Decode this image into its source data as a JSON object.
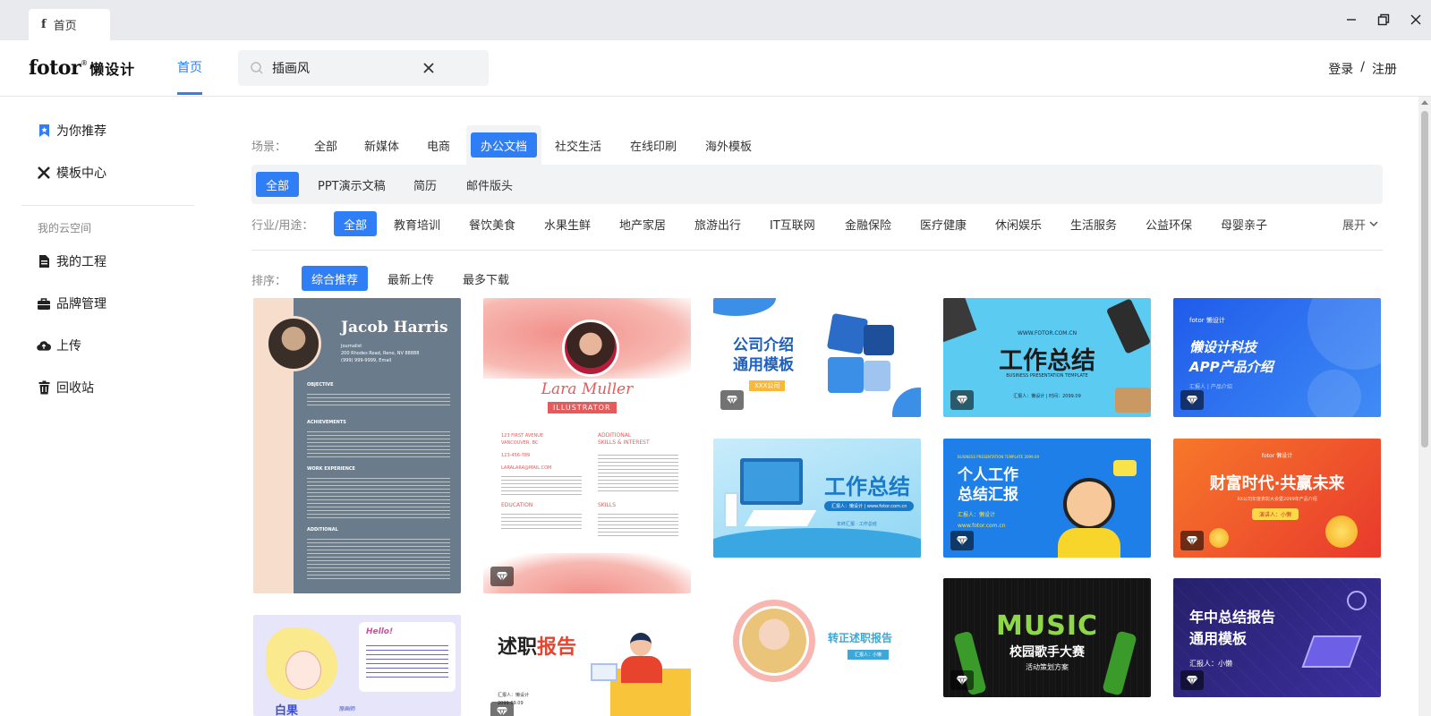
{
  "window": {
    "tab_label": "首页",
    "tab_icon": "f"
  },
  "header": {
    "logo_text": "fotor",
    "logo_reg": "®",
    "logo_sub": "懒设计",
    "nav_home": "首页",
    "search_value": "插画风",
    "login": "登录",
    "separator": "/",
    "register": "注册",
    "accent": "#2f7ef5"
  },
  "sidebar": {
    "recommend": "为你推荐",
    "template_center": "模板中心",
    "cloud_section": "我的云空间",
    "my_projects": "我的工程",
    "brand": "品牌管理",
    "upload": "上传",
    "trash": "回收站"
  },
  "filters": {
    "scene_label": "场景：",
    "scenes": [
      "全部",
      "新媒体",
      "电商",
      "办公文档",
      "社交生活",
      "在线印刷",
      "海外模板"
    ],
    "scene_active": "办公文档",
    "sub": [
      "全部",
      "PPT演示文稿",
      "简历",
      "邮件版头"
    ],
    "sub_active": "全部",
    "industry_label": "行业/用途：",
    "industries": [
      "全部",
      "教育培训",
      "餐饮美食",
      "水果生鲜",
      "地产家居",
      "旅游出行",
      "IT互联网",
      "金融保险",
      "医疗健康",
      "休闲娱乐",
      "生活服务",
      "公益环保",
      "母婴亲子"
    ],
    "industry_active": "全部",
    "expand": "展开",
    "sort_label": "排序：",
    "sorts": [
      "综合推荐",
      "最新上传",
      "最多下载"
    ],
    "sort_active": "综合推荐"
  },
  "cards": {
    "resume1": {
      "name": "Jacob Harris",
      "role": "Journalist",
      "address": "200 Rhodes Road, Reno, NV 88888",
      "contact": "(999) 999-9999, Email",
      "sections": [
        "OBJECTIVE",
        "ACHIEVEMENTS",
        "WORK EXPERIENCE",
        "ADDITIONAL"
      ]
    },
    "resume2": {
      "name": "Lara Muller",
      "role": "ILLUSTRATOR",
      "address1": "123 FIRST AVENUE",
      "address2": "VANCOUVER, BC",
      "phone": "123-456-789",
      "email": "LARALARA@MAIL.COM",
      "skills_title1": "ADDITIONAL",
      "skills_title2": "SKILLS & INTEREST",
      "education": "EDUCATION",
      "skills": "SKILLS"
    },
    "company": {
      "line1": "公司介绍",
      "line2": "通用模板",
      "tag": "XXX公司"
    },
    "work_summary1": {
      "url": "WWW.FOTOR.COM.CN",
      "title": "工作总结",
      "sub": "BUSINESS PRESENTATION TEMPLATE",
      "reporter": "汇报人：懒设计 | 时间：2099.09"
    },
    "app_intro": {
      "brand": "fotor 懒设计",
      "line1": "懒设计科技",
      "line2": "APP产品介绍",
      "sub": "汇报人 | 产品介绍"
    },
    "work_summary2": {
      "title": "工作总结",
      "reporter": "汇报人：懒设计 | www.fotor.com.cn",
      "sub": "年终汇报 · 工作总结"
    },
    "personal": {
      "top": "BUSINESS PRESENTATION TEMPLATE 2099.09",
      "line1": "个人工作",
      "line2": "总结汇报",
      "reporter": "汇报人：懒设计",
      "url": "www.fotor.com.cn"
    },
    "wealth": {
      "brand": "fotor 懒设计",
      "title": "财富时代·共赢未来",
      "sub": "XX公司年度表彰大会暨2099年产品介绍",
      "speaker": "演讲人：小懒"
    },
    "illustration": {
      "hello": "Hello!",
      "name": "白果",
      "sub": "原画师"
    },
    "report": {
      "part1": "述职",
      "part2": "报告",
      "reporter": "汇报人：懒设计",
      "date": "2099.09.09"
    },
    "regular": {
      "title": "转正述职报告",
      "reporter": "汇报人：小懒"
    },
    "music": {
      "title": "MUSIC",
      "sub": "校园歌手大赛",
      "sub2": "活动策划方案"
    },
    "midyear": {
      "line1": "年中总结报告",
      "line2": "通用模板",
      "reporter": "汇报人：小懒"
    }
  }
}
